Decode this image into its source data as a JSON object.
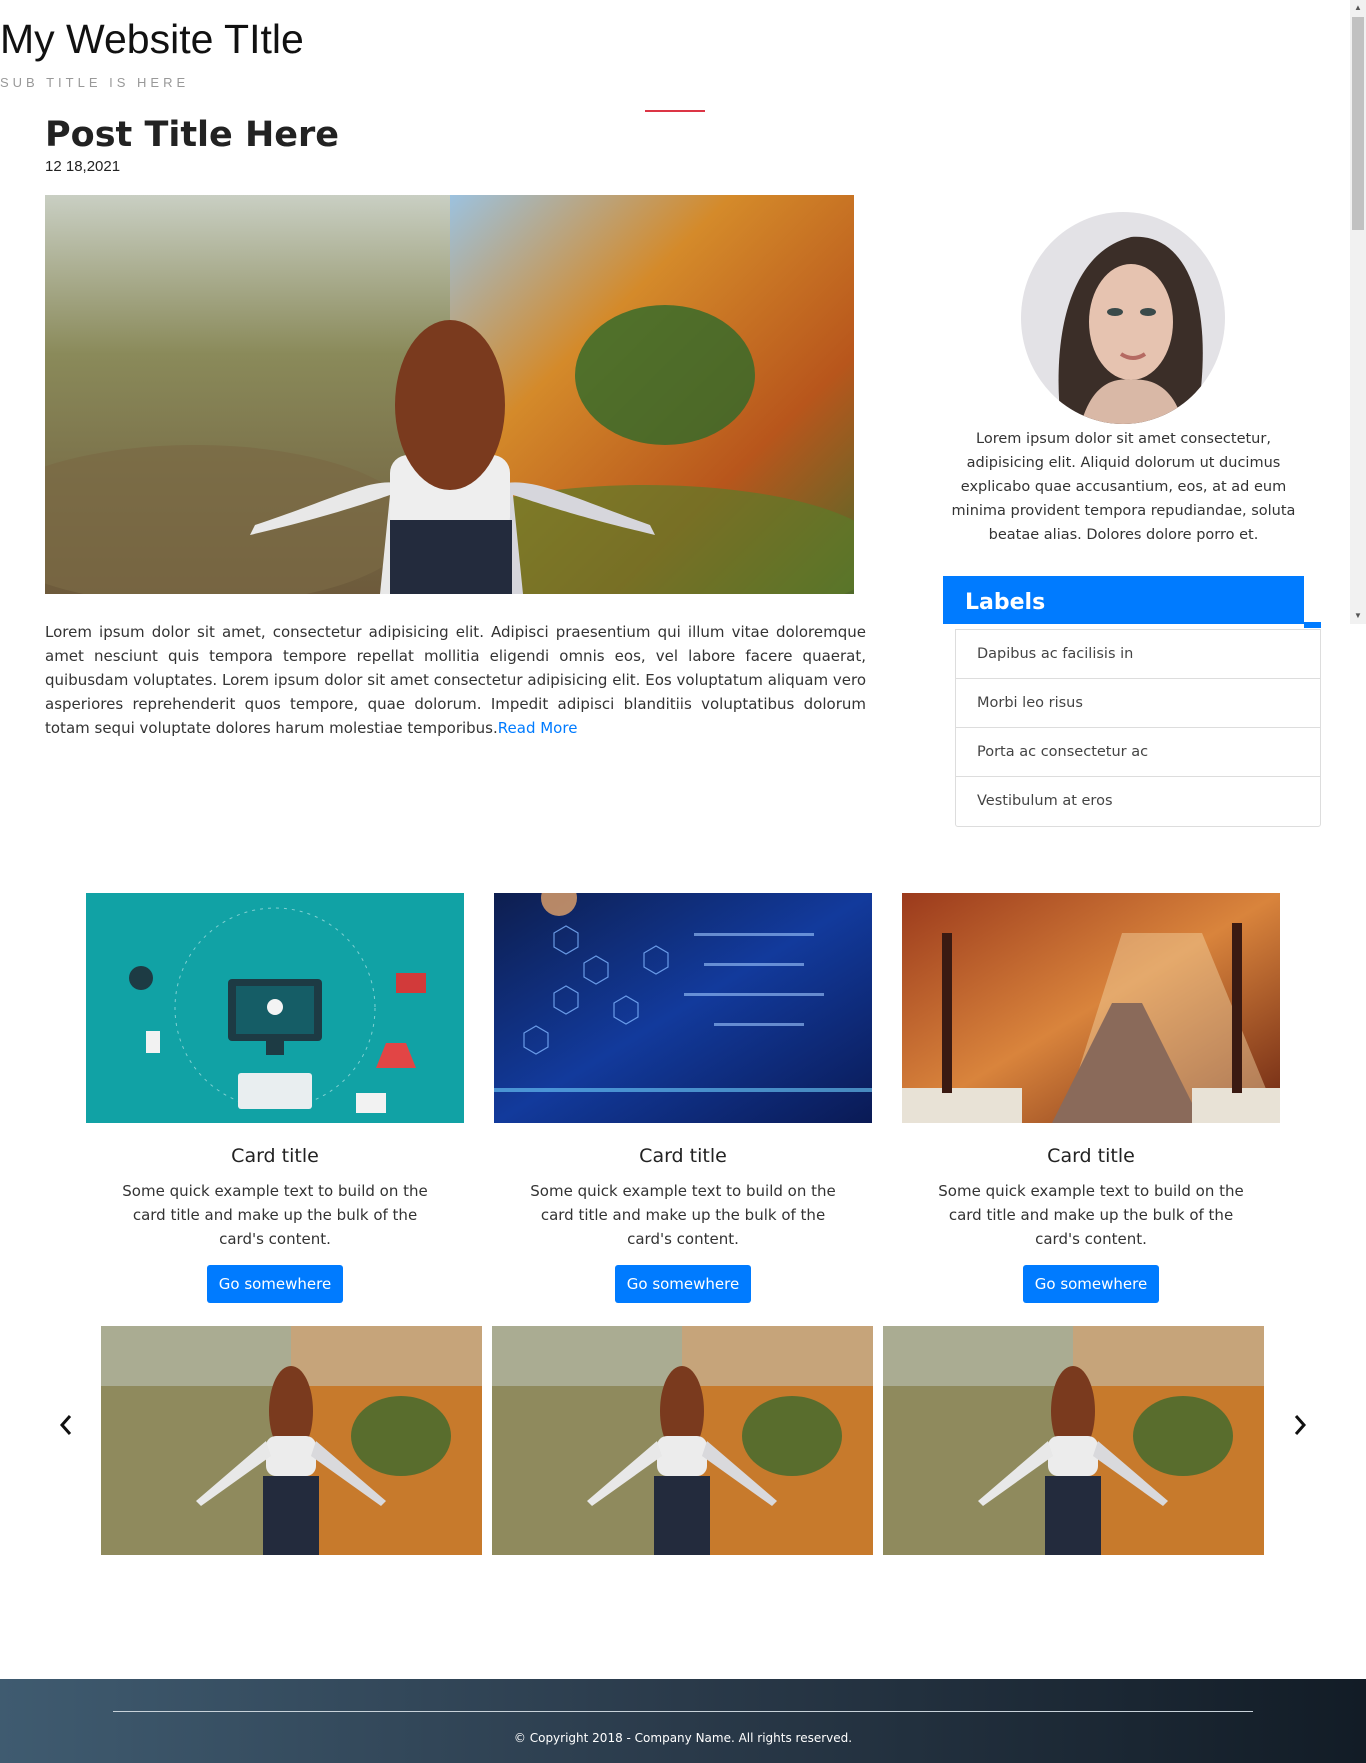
{
  "header": {
    "title": "My Website TItle",
    "subtitle": "SUB TITLE IS HERE"
  },
  "post": {
    "title": "Post Title Here",
    "date": "12 18,2021",
    "body": "Lorem ipsum dolor sit amet, consectetur adipisicing elit. Adipisci praesentium qui illum vitae doloremque amet nesciunt quis tempora tempore repellat mollitia eligendi omnis eos, vel labore facere quaerat, quibusdam voluptates. Lorem ipsum dolor sit amet consectetur adipisicing elit. Eos voluptatum aliquam vero asperiores reprehenderit quos tempore, quae dolorum. Impedit adipisci blanditiis voluptatibus dolorum totam sequi voluptate dolores harum molestiae temporibus.",
    "read_more": "Read More"
  },
  "sidebar": {
    "bio": "Lorem ipsum dolor sit amet consectetur, adipisicing elit. Aliquid dolorum ut ducimus explicabo quae accusantium, eos, at ad eum minima provident tempora repudiandae, soluta beatae alias. Dolores dolore porro et.",
    "labels_title": "Labels",
    "labels": [
      "Dapibus ac facilisis in",
      "Morbi leo risus",
      "Porta ac consectetur ac",
      "Vestibulum at eros"
    ]
  },
  "cards": [
    {
      "title": "Card title",
      "text": "Some quick example text to build on the card title and make up the bulk of the card's content.",
      "button": "Go somewhere"
    },
    {
      "title": "Card title",
      "text": "Some quick example text to build on the card title and make up the bulk of the card's content.",
      "button": "Go somewhere"
    },
    {
      "title": "Card title",
      "text": "Some quick example text to build on the card title and make up the bulk of the card's content.",
      "button": "Go somewhere"
    }
  ],
  "footer": {
    "copyright": "© Copyright 2018 - Company Name. All rights reserved."
  },
  "colors": {
    "accent": "#007bff",
    "title_rule": "#dc3545"
  },
  "icons": {
    "carousel_prev": "chevron-left-icon",
    "carousel_next": "chevron-right-icon"
  }
}
